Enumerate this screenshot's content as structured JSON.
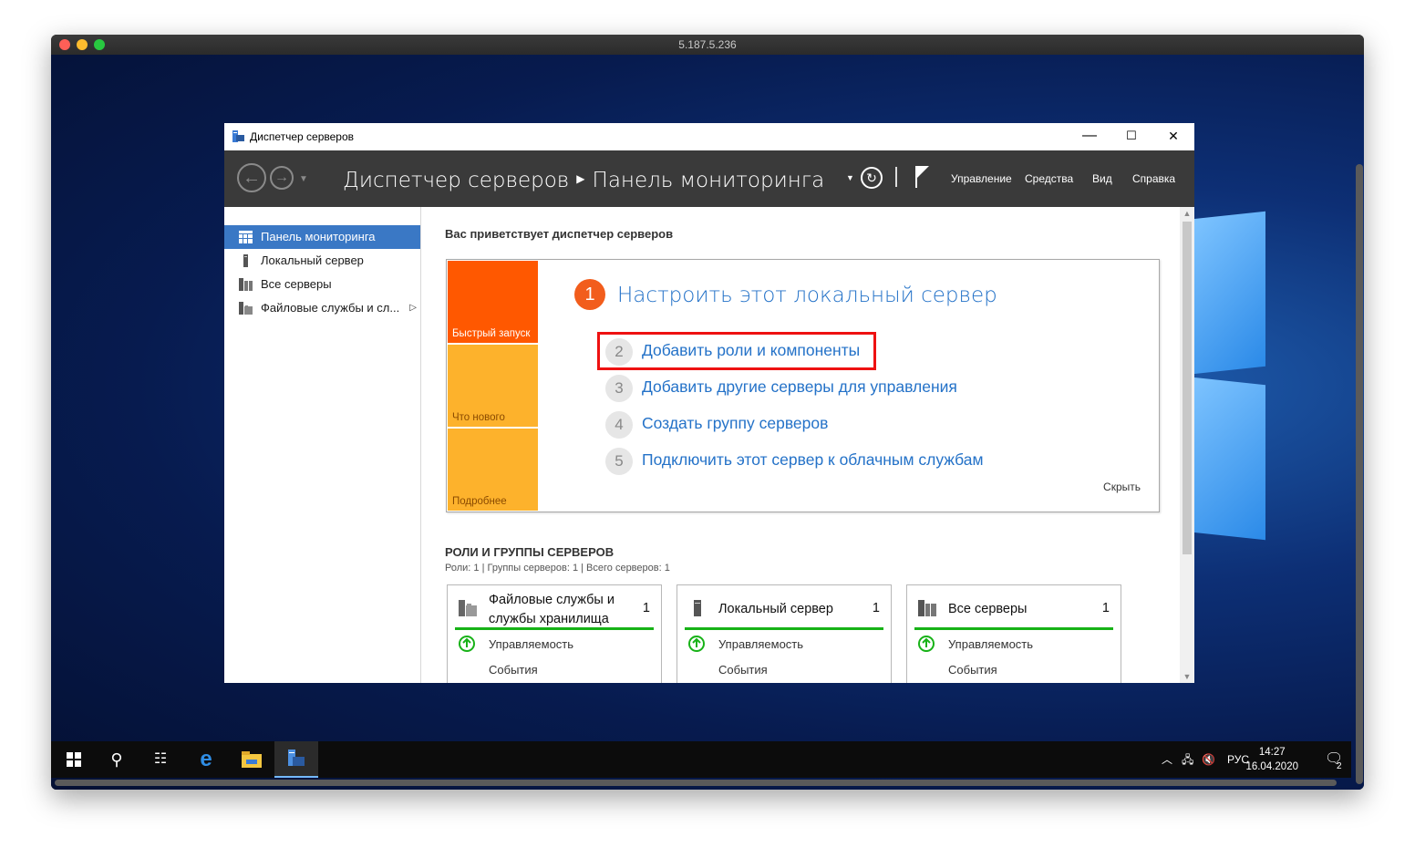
{
  "host": {
    "title": "5.187.5.236"
  },
  "window": {
    "title": "Диспетчер серверов",
    "minimize_glyph": "—",
    "maximize_glyph": "☐",
    "close_glyph": "✕"
  },
  "toolbar": {
    "breadcrumb_root": "Диспетчер серверов",
    "breadcrumb_current": "Панель мониторинга",
    "menu": [
      "Управление",
      "Средства",
      "Вид",
      "Справка"
    ],
    "icons": [
      "back-arrow-icon",
      "forward-arrow-icon",
      "refresh-icon",
      "flag-icon"
    ]
  },
  "sidebar": {
    "items": [
      {
        "label": "Панель мониторинга",
        "icon": "dashboard-icon",
        "active": true
      },
      {
        "label": "Локальный сервер",
        "icon": "server-icon",
        "active": false
      },
      {
        "label": "Все серверы",
        "icon": "servers-icon",
        "active": false
      },
      {
        "label": "Файловые службы и сл...",
        "icon": "file-services-icon",
        "active": false,
        "has_submenu": true
      }
    ]
  },
  "main": {
    "welcome": "Вас приветствует диспетчер серверов",
    "tiles": [
      {
        "label": "Быстрый запуск",
        "color": "#ff5800"
      },
      {
        "label": "Что нового",
        "color": "#fdb22c"
      },
      {
        "label": "Подробнее",
        "color": "#fdb22c"
      }
    ],
    "step1": {
      "num": "1",
      "label": "Настроить этот локальный сервер"
    },
    "steps": [
      {
        "num": "2",
        "label": "Добавить роли и компоненты"
      },
      {
        "num": "3",
        "label": "Добавить другие серверы для управления"
      },
      {
        "num": "4",
        "label": "Создать группу серверов"
      },
      {
        "num": "5",
        "label": "Подключить этот сервер к облачным службам"
      }
    ],
    "hide": "Скрыть",
    "roles_title": "РОЛИ И ГРУППЫ СЕРВЕРОВ",
    "roles_sub": "Роли: 1 | Группы серверов: 1 | Всего серверов: 1",
    "cards": [
      {
        "title": "Файловые службы и службы хранилища",
        "count": "1",
        "row1": "Управляемость",
        "row2": "События",
        "icon": "file-services-icon"
      },
      {
        "title": "Локальный сервер",
        "count": "1",
        "row1": "Управляемость",
        "row2": "События",
        "icon": "server-icon"
      },
      {
        "title": "Все серверы",
        "count": "1",
        "row1": "Управляемость",
        "row2": "События",
        "icon": "servers-icon"
      }
    ],
    "status_color": "#17b217"
  },
  "taskbar": {
    "icons": [
      "windows-start-icon",
      "search-icon",
      "task-view-icon",
      "internet-explorer-icon",
      "file-explorer-icon",
      "server-manager-icon"
    ],
    "language": "РУС",
    "time": "14:27",
    "date": "16.04.2020",
    "notifications": "2"
  }
}
